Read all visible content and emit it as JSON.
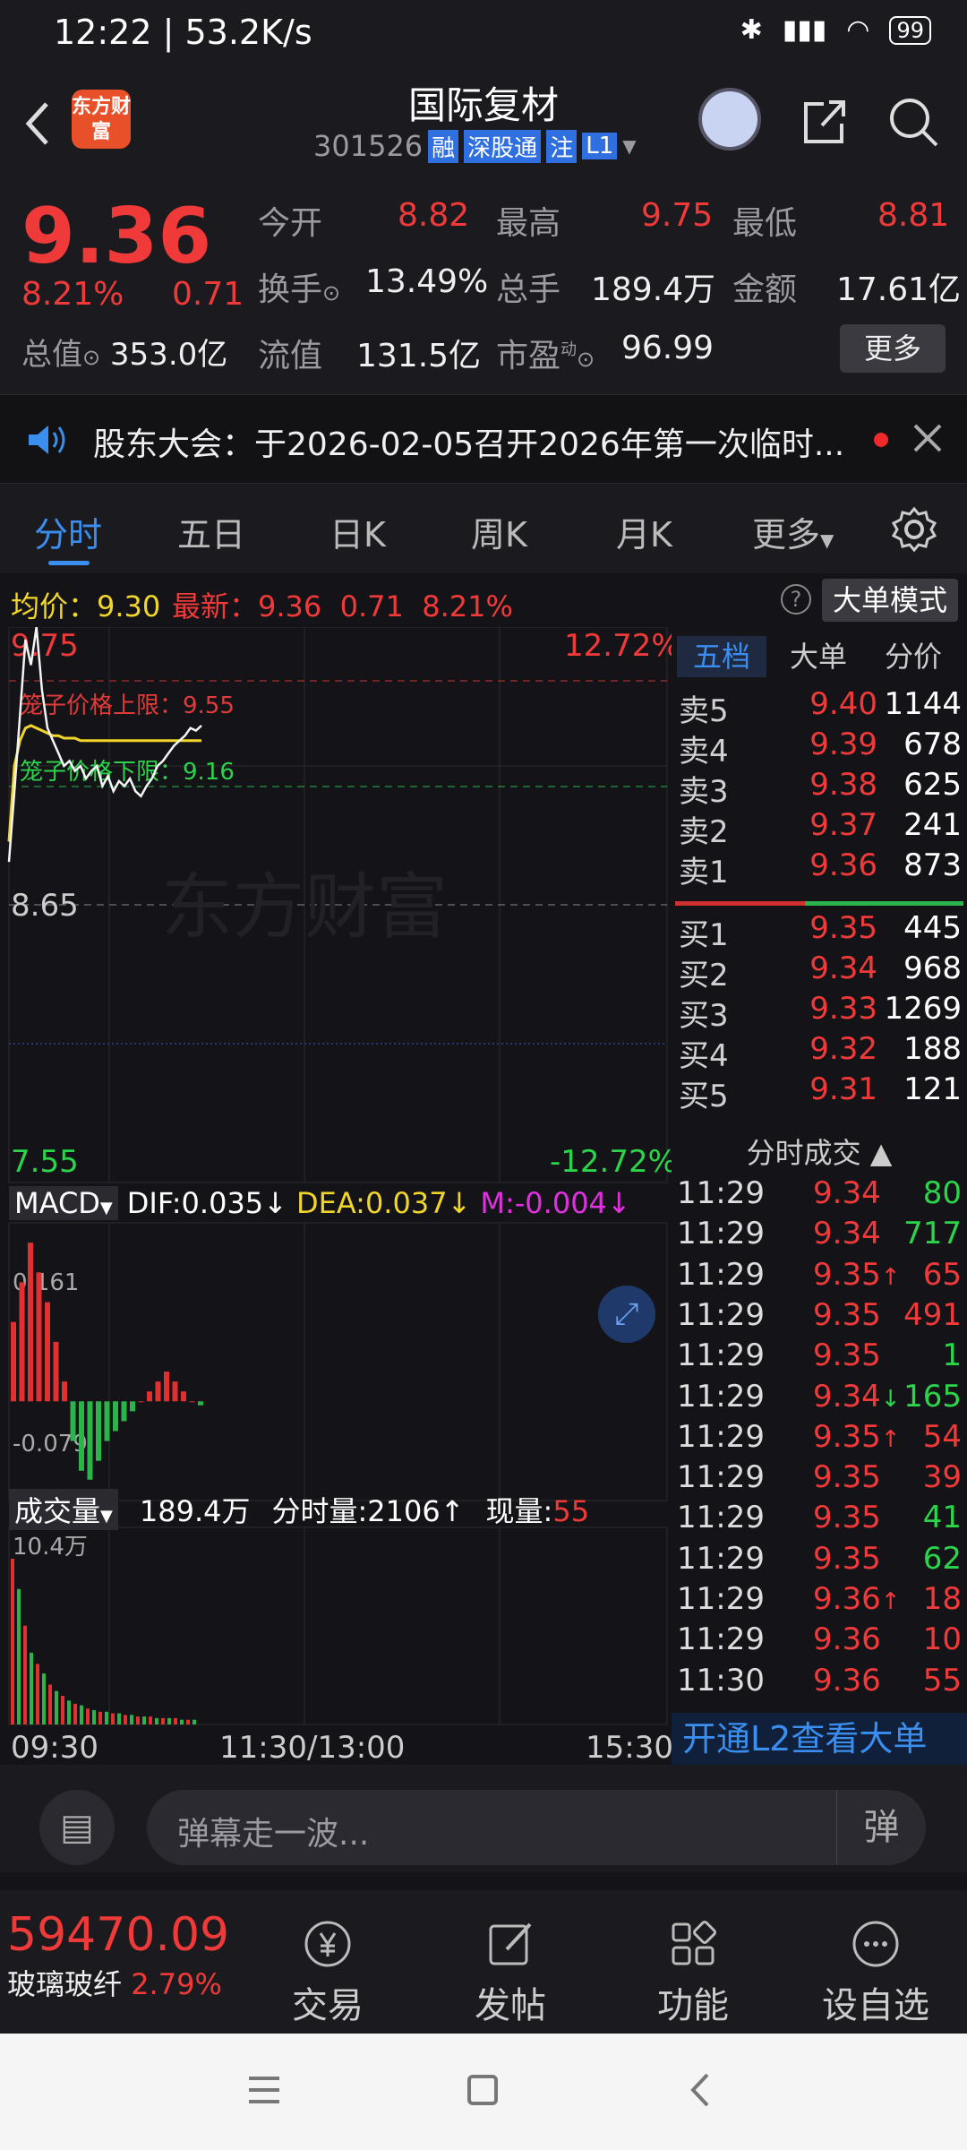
{
  "status_bar": {
    "time": "12:22",
    "net_speed": "53.2K/s",
    "battery": "99"
  },
  "header": {
    "app_logo_text": "东方财富",
    "stock_name": "国际复材",
    "stock_code": "301526",
    "tags": [
      "融",
      "深股通",
      "注",
      "L1"
    ]
  },
  "quote": {
    "price": "9.36",
    "change_pct": "8.21%",
    "change": "0.71",
    "total_value_label": "总值",
    "total_value": "353.0亿",
    "rows": [
      [
        {
          "label": "今开",
          "value": "8.82",
          "color": "red"
        },
        {
          "label": "最高",
          "value": "9.75",
          "color": "red"
        },
        {
          "label": "最低",
          "value": "8.81",
          "color": "red"
        }
      ],
      [
        {
          "label": "换手",
          "value": "13.49%",
          "color": "white"
        },
        {
          "label": "总手",
          "value": "189.4万",
          "color": "white"
        },
        {
          "label": "金额",
          "value": "17.61亿",
          "color": "white"
        }
      ],
      [
        {
          "label": "流值",
          "value": "131.5亿",
          "color": "white"
        },
        {
          "label": "市盈",
          "value": "96.99",
          "color": "white"
        }
      ]
    ],
    "pe_superscript": "动",
    "more_button": "更多"
  },
  "notice": {
    "text": "股东大会：于2026-02-05召开2026年第一次临时..."
  },
  "tabs": [
    "分时",
    "五日",
    "日K",
    "周K",
    "月K",
    "更多"
  ],
  "info_bar": {
    "avg_label": "均价：",
    "avg_value": "9.30",
    "latest_label": "最新：",
    "latest_value": "9.36",
    "change": "0.71",
    "change_pct": "8.21%",
    "big_order_mode": "大单模式"
  },
  "chart_data": {
    "type": "line",
    "title": "",
    "y_top": "9.75",
    "y_mid": "8.65",
    "y_bottom": "7.55",
    "pct_top": "12.72%",
    "pct_bottom": "-12.72%",
    "upper_limit_label": "笼子价格上限：9.55",
    "lower_limit_label": "笼子价格下限：9.16",
    "ylim": [
      7.55,
      9.75
    ],
    "time_labels": [
      "09:30",
      "11:30/13:00",
      "15:30"
    ],
    "price_series": {
      "name": "最新",
      "values": [
        8.82,
        9.1,
        9.4,
        9.7,
        9.6,
        9.75,
        9.5,
        9.35,
        9.3,
        9.25,
        9.2,
        9.22,
        9.18,
        9.2,
        9.15,
        9.18,
        9.2,
        9.12,
        9.16,
        9.1,
        9.14,
        9.12,
        9.15,
        9.1,
        9.08,
        9.12,
        9.15,
        9.2,
        9.22,
        9.25,
        9.28,
        9.3,
        9.32,
        9.35,
        9.34,
        9.36
      ]
    },
    "avg_series": {
      "name": "均价",
      "values": [
        8.9,
        9.2,
        9.3,
        9.35,
        9.36,
        9.35,
        9.34,
        9.33,
        9.32,
        9.32,
        9.31,
        9.31,
        9.31,
        9.3,
        9.3,
        9.3,
        9.3,
        9.3,
        9.3,
        9.3,
        9.3,
        9.3,
        9.3,
        9.3,
        9.3,
        9.3,
        9.3,
        9.3,
        9.3,
        9.3,
        9.3,
        9.3,
        9.3,
        9.3,
        9.3,
        9.3
      ]
    }
  },
  "macd": {
    "label": "MACD",
    "dif": "DIF:0.035",
    "dea": "DEA:0.037",
    "m": "M:-0.004",
    "top": "0.161",
    "bottom": "-0.079",
    "values": [
      0.08,
      0.12,
      0.16,
      0.13,
      0.1,
      0.06,
      0.02,
      -0.04,
      -0.07,
      -0.079,
      -0.06,
      -0.04,
      -0.03,
      -0.02,
      -0.01,
      0.0,
      0.01,
      0.02,
      0.03,
      0.02,
      0.01,
      0.0,
      -0.004
    ]
  },
  "volume": {
    "label": "成交量",
    "total": "189.4万",
    "tick_vol": "分时量:2106",
    "current_label": "现量:",
    "current": "55",
    "top": "10.4万",
    "values": [
      10.4,
      8.5,
      6.2,
      4.5,
      3.8,
      3.2,
      2.5,
      2.1,
      1.8,
      1.5,
      1.3,
      1.2,
      1.0,
      0.9,
      0.8,
      0.8,
      0.7,
      0.7,
      0.6,
      0.6,
      0.5,
      0.5,
      0.5,
      0.4,
      0.4,
      0.4,
      0.4,
      0.3,
      0.3,
      0.3
    ]
  },
  "book": {
    "tabs": [
      "五档",
      "大单",
      "分价"
    ],
    "asks": [
      {
        "label": "卖5",
        "price": "9.40",
        "vol": "1144"
      },
      {
        "label": "卖4",
        "price": "9.39",
        "vol": "678"
      },
      {
        "label": "卖3",
        "price": "9.38",
        "vol": "625"
      },
      {
        "label": "卖2",
        "price": "9.37",
        "vol": "241"
      },
      {
        "label": "卖1",
        "price": "9.36",
        "vol": "873"
      }
    ],
    "bids": [
      {
        "label": "买1",
        "price": "9.35",
        "vol": "445"
      },
      {
        "label": "买2",
        "price": "9.34",
        "vol": "968"
      },
      {
        "label": "买3",
        "price": "9.33",
        "vol": "1269"
      },
      {
        "label": "买4",
        "price": "9.32",
        "vol": "188"
      },
      {
        "label": "买5",
        "price": "9.31",
        "vol": "121"
      }
    ],
    "trades_title": "分时成交",
    "trades": [
      {
        "time": "11:29",
        "price": "9.34",
        "vol": "80",
        "dir": "",
        "color": "green"
      },
      {
        "time": "11:29",
        "price": "9.34",
        "vol": "717",
        "dir": "",
        "color": "green"
      },
      {
        "time": "11:29",
        "price": "9.35",
        "vol": "65",
        "dir": "↑",
        "color": "red"
      },
      {
        "time": "11:29",
        "price": "9.35",
        "vol": "491",
        "dir": "",
        "color": "red"
      },
      {
        "time": "11:29",
        "price": "9.35",
        "vol": "1",
        "dir": "",
        "color": "green"
      },
      {
        "time": "11:29",
        "price": "9.34",
        "vol": "165",
        "dir": "↓",
        "color": "green"
      },
      {
        "time": "11:29",
        "price": "9.35",
        "vol": "54",
        "dir": "↑",
        "color": "red"
      },
      {
        "time": "11:29",
        "price": "9.35",
        "vol": "39",
        "dir": "",
        "color": "red"
      },
      {
        "time": "11:29",
        "price": "9.35",
        "vol": "41",
        "dir": "",
        "color": "green"
      },
      {
        "time": "11:29",
        "price": "9.35",
        "vol": "62",
        "dir": "",
        "color": "green"
      },
      {
        "time": "11:29",
        "price": "9.36",
        "vol": "18",
        "dir": "↑",
        "color": "red"
      },
      {
        "time": "11:29",
        "price": "9.36",
        "vol": "10",
        "dir": "",
        "color": "red"
      },
      {
        "time": "11:30",
        "price": "9.36",
        "vol": "55",
        "dir": "",
        "color": "red"
      }
    ],
    "l2_promo": "开通L2查看大单"
  },
  "danmu": {
    "placeholder": "弹幕走一波..."
  },
  "bottom_bar": {
    "index_value": "59470.09",
    "index_name": "玻璃玻纤",
    "index_change": "2.79%",
    "items": [
      {
        "label": "交易",
        "icon": "yen-icon"
      },
      {
        "label": "发帖",
        "icon": "edit-icon"
      },
      {
        "label": "功能",
        "icon": "grid-icon"
      },
      {
        "label": "设自选",
        "icon": "more-icon"
      }
    ]
  },
  "watermark": "东方财富"
}
